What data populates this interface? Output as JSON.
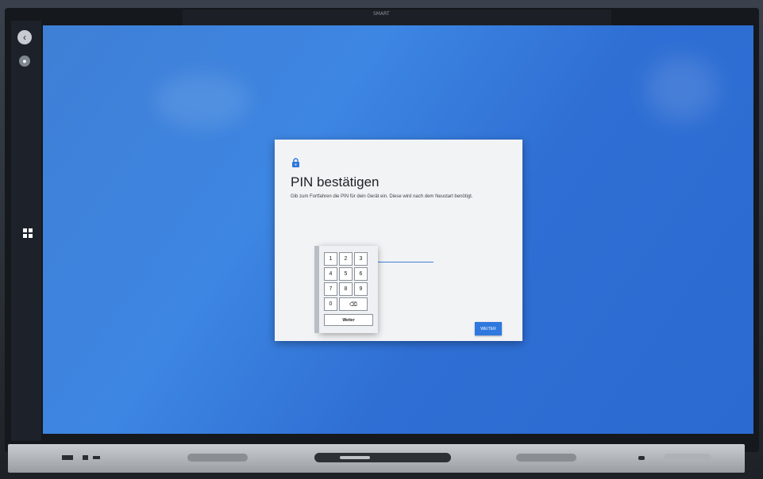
{
  "display": {
    "brand": "SMART"
  },
  "sidebar": {
    "back_icon": "back-icon",
    "profile_icon": "profile-icon",
    "apps_icon": "apps-grid-icon",
    "back_glyph": "‹",
    "profile_glyph": "●"
  },
  "dialog": {
    "icon": "lock-icon",
    "title": "PIN bestätigen",
    "description": "Gib zum Fortfahren die PIN für dein Gerät ein. Diese wird nach dem Neustart benötigt.",
    "pin_value": "",
    "button_label": "WEITER",
    "accent_color": "#2e78de"
  },
  "keypad": {
    "keys": [
      "1",
      "2",
      "3",
      "4",
      "5",
      "6",
      "7",
      "8",
      "9",
      "0"
    ],
    "backspace_icon": "backspace-icon",
    "backspace_glyph": "⌫",
    "enter_label": "Weiter"
  }
}
